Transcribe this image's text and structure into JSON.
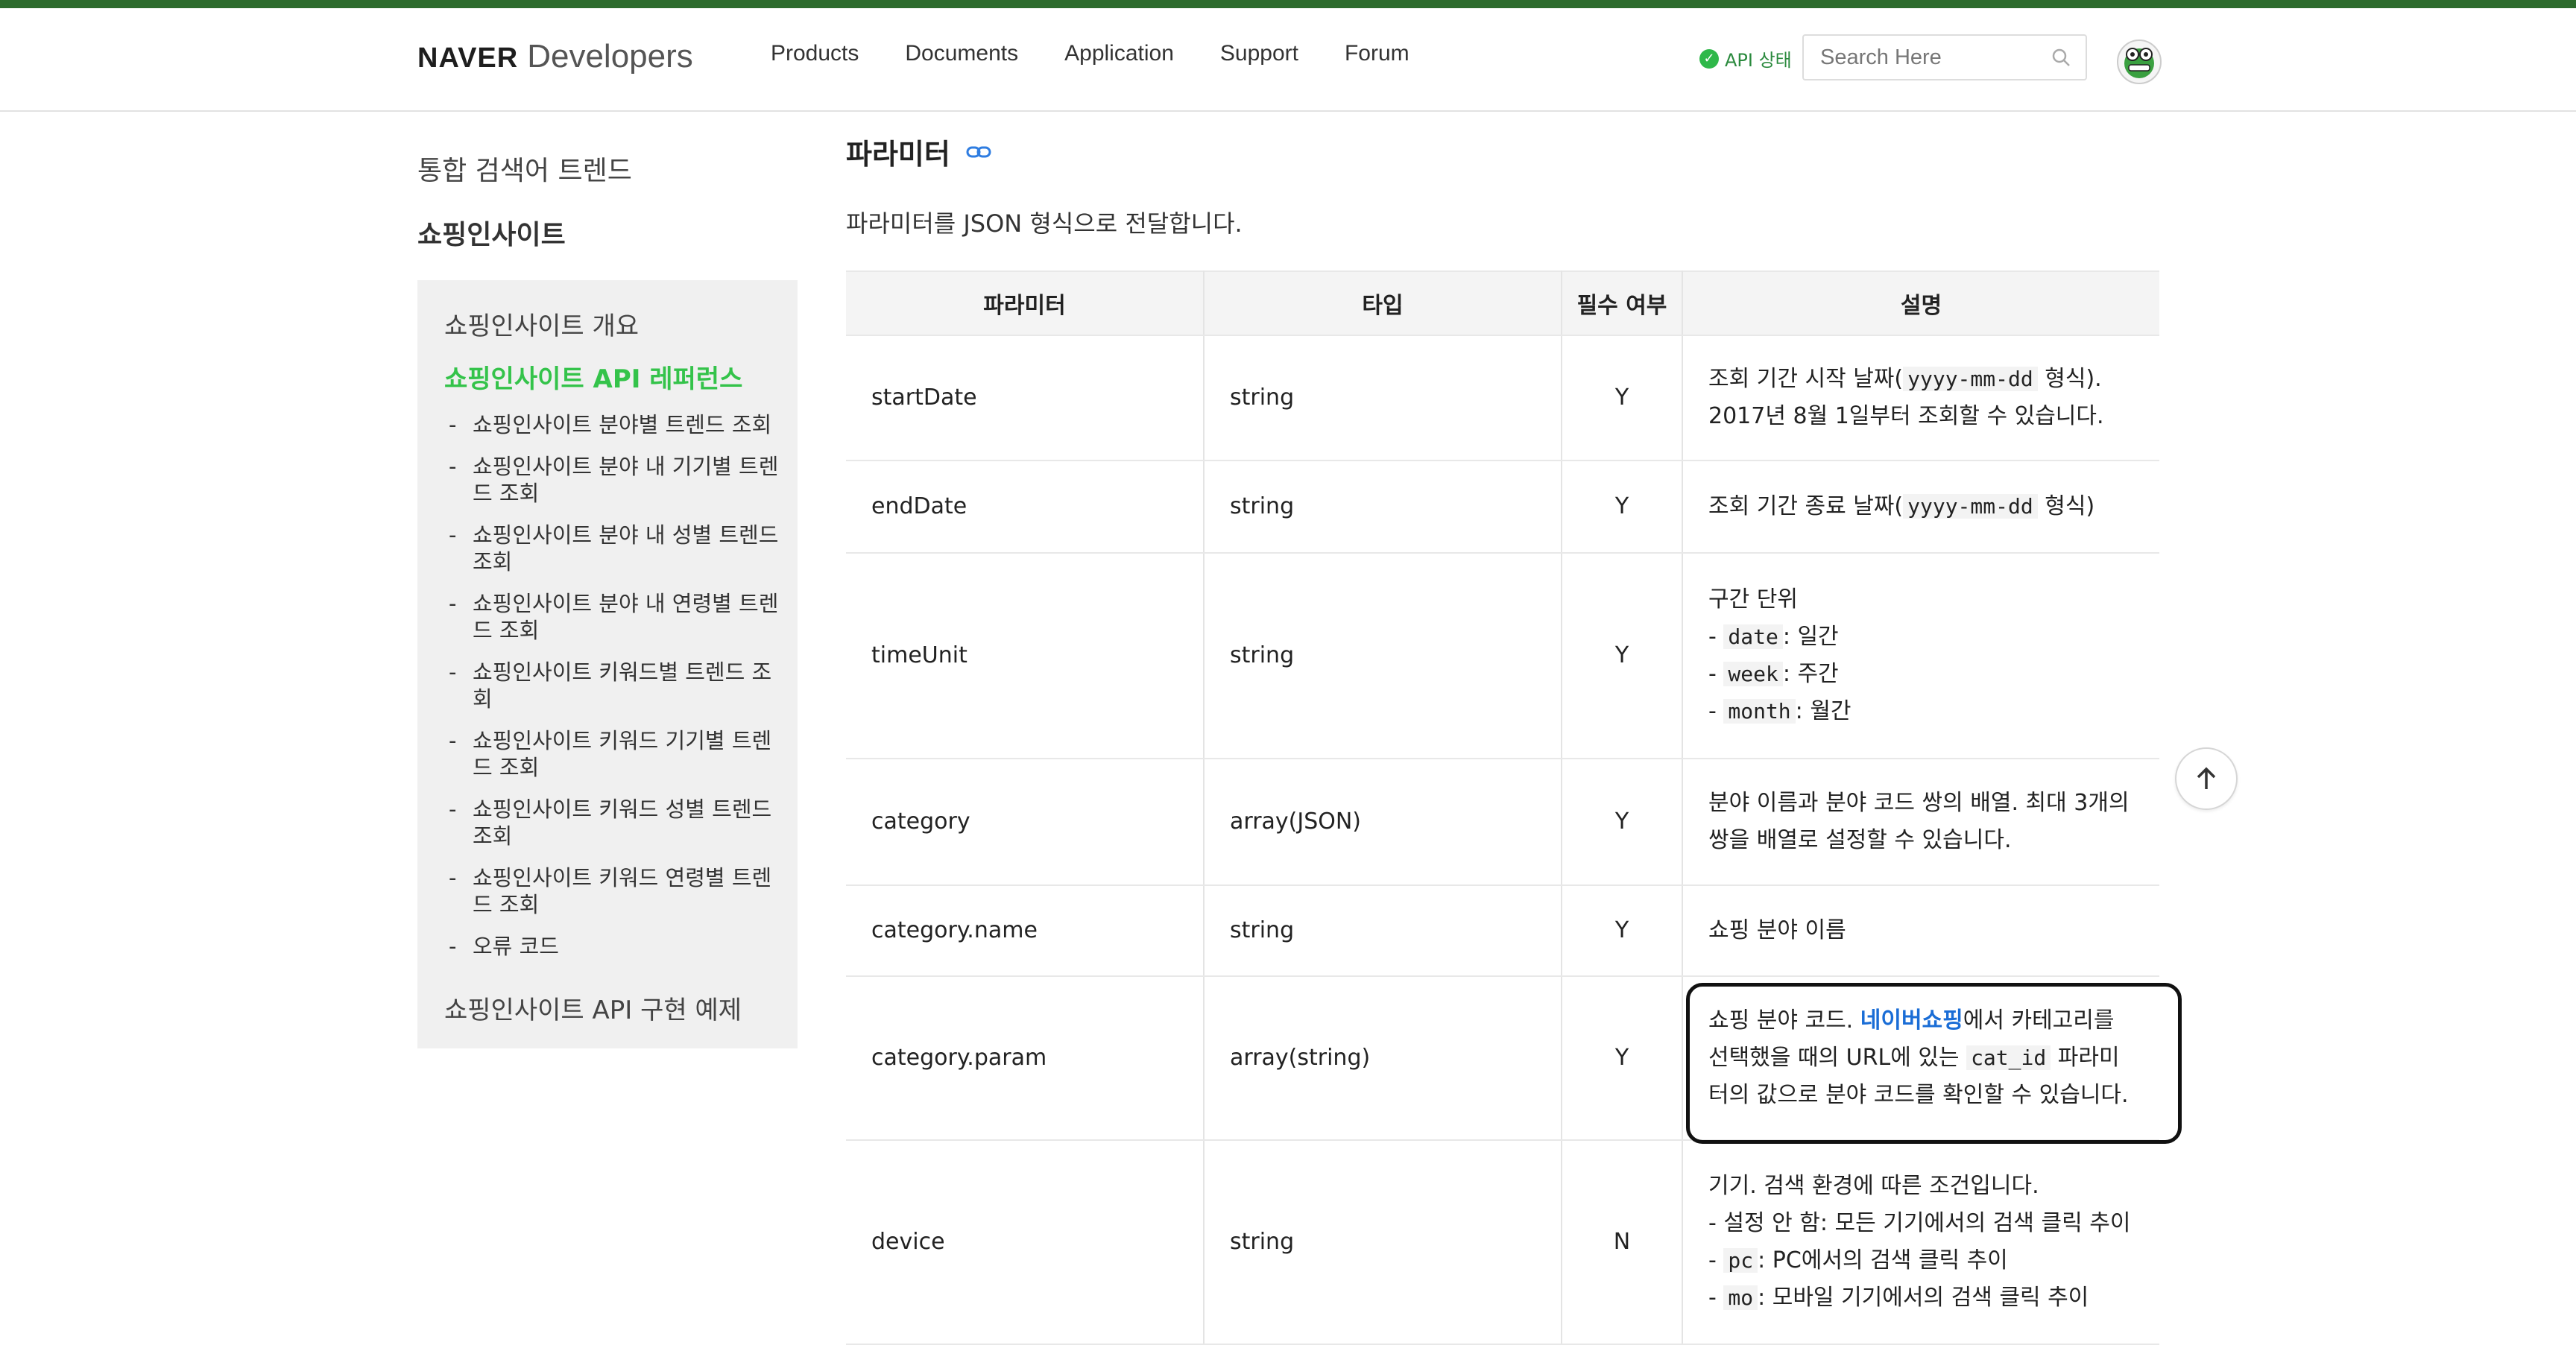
{
  "header": {
    "brand_bold": "NAVER",
    "brand_light": "Developers",
    "nav": [
      "Products",
      "Documents",
      "Application",
      "Support",
      "Forum"
    ],
    "api_status": "API 상태",
    "search_placeholder": "Search Here"
  },
  "sidebar": {
    "top_items": [
      "통합 검색어 트렌드",
      "쇼핑인사이트"
    ],
    "box_title": "쇼핑인사이트 개요",
    "active_title": "쇼핑인사이트 API 레퍼런스",
    "sub_items": [
      "쇼핑인사이트 분야별 트렌드 조회",
      "쇼핑인사이트 분야 내 기기별 트렌드 조회",
      "쇼핑인사이트 분야 내 성별 트렌드 조회",
      "쇼핑인사이트 분야 내 연령별 트렌드 조회",
      "쇼핑인사이트 키워드별 트렌드 조회",
      "쇼핑인사이트 키워드 기기별 트렌드 조회",
      "쇼핑인사이트 키워드 성별 트렌드 조회",
      "쇼핑인사이트 키워드 연령별 트렌드 조회",
      "오류 코드"
    ],
    "bottom_item": "쇼핑인사이트 API 구현 예제"
  },
  "content": {
    "section_title": "파라미터",
    "section_desc": "파라미터를 JSON 형식으로 전달합니다.",
    "table_headers": [
      "파라미터",
      "타입",
      "필수 여부",
      "설명"
    ],
    "rows": [
      {
        "param": "startDate",
        "type": "string",
        "required": "Y",
        "desc_a": "조회 기간 시작 날짜(",
        "desc_code": "yyyy-mm-dd",
        "desc_b": " 형식). 2017년 8월 1일부터 조회할 수 있습니다."
      },
      {
        "param": "endDate",
        "type": "string",
        "required": "Y",
        "desc_a": "조회 기간 종료 날짜(",
        "desc_code": "yyyy-mm-dd",
        "desc_b": " 형식)"
      },
      {
        "param": "timeUnit",
        "type": "string",
        "required": "Y",
        "desc_title": "구간 단위",
        "desc_items": [
          {
            "code": "date",
            "text": ": 일간"
          },
          {
            "code": "week",
            "text": ": 주간"
          },
          {
            "code": "month",
            "text": ": 월간"
          }
        ]
      },
      {
        "param": "category",
        "type": "array(JSON)",
        "required": "Y",
        "desc_a": "분야 이름과 분야 코드 쌍의 배열. 최대 3개의 쌍을 배열로 설정할 수 있습니다."
      },
      {
        "param": "category.name",
        "type": "string",
        "required": "Y",
        "desc_a": "쇼핑 분야 이름"
      },
      {
        "param": "category.param",
        "type": "array(string)",
        "required": "Y",
        "desc_a": "쇼핑 분야 코드. ",
        "desc_link": "네이버쇼핑",
        "desc_b": "에서 카테고리를 선택했을 때의 URL에 있는 ",
        "desc_code": "cat_id",
        "desc_c": " 파라미터의 값으로 분야 코드를 확인할 수 있습니다."
      },
      {
        "param": "device",
        "type": "string",
        "required": "N",
        "desc_title": "기기. 검색 환경에 따른 조건입니다.",
        "desc_line1": "- 설정 안 함: 모든 기기에서의 검색 클릭 추이",
        "desc_items": [
          {
            "code": "pc",
            "text": ": PC에서의 검색 클릭 추이"
          },
          {
            "code": "mo",
            "text": ": 모바일 기기에서의 검색 클릭 추이"
          }
        ]
      }
    ]
  },
  "icons": {
    "status": "check-circle-icon",
    "search": "search-icon",
    "link": "link-icon",
    "scroll_top": "arrow-up-icon"
  },
  "colors": {
    "accent_bar": "#2d6b2d",
    "active_green": "#34c34a",
    "link_blue": "#1a6dd6"
  }
}
